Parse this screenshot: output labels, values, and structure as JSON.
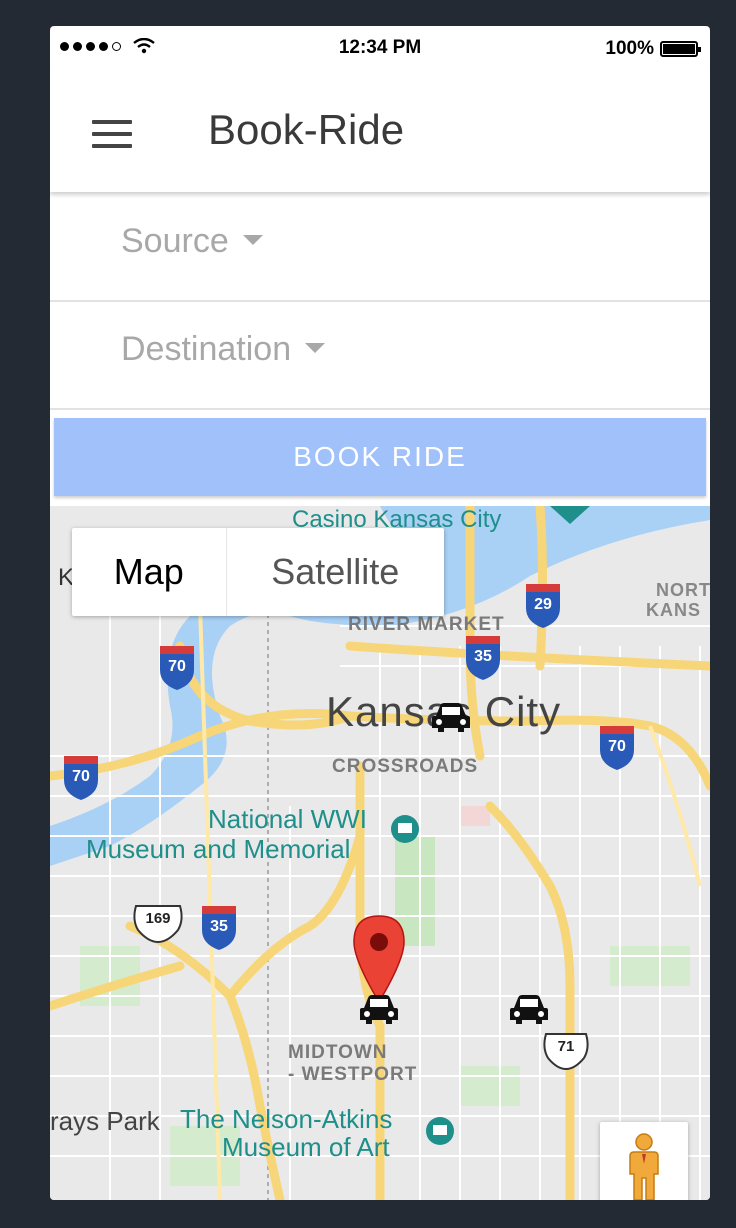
{
  "status_bar": {
    "time": "12:34 PM",
    "battery": "100%"
  },
  "app_bar": {
    "title": "Book-Ride",
    "menu_icon": "hamburger-menu-icon"
  },
  "form": {
    "source_label": "Source",
    "destination_label": "Destination",
    "book_button": "BOOK RIDE"
  },
  "map": {
    "type_control": {
      "map": "Map",
      "satellite": "Satellite",
      "selected": "Map"
    },
    "labels": {
      "casino": "Casino Kansas City",
      "river_market": "RIVER MARKET",
      "kansas_city": "Kansas City",
      "crossroads": "CROSSROADS",
      "wwi_line1": "National WWI",
      "wwi_line2": "Museum and Memorial",
      "midtown1": "MIDTOWN",
      "midtown2": "- WESTPORT",
      "nelson1": "The Nelson-Atkins",
      "nelson2": "Museum of Art",
      "park": "rays Park",
      "north1": "NORT",
      "north2": "KANS",
      "left_k": "K"
    },
    "shields": {
      "i29": "29",
      "i35a": "35",
      "i70a": "70",
      "i70b": "70",
      "i70c": "70",
      "i35b": "35",
      "us169": "169",
      "us71": "71"
    },
    "icons": [
      "car-icon",
      "map-pin-icon",
      "pegman-icon"
    ],
    "colors": {
      "road_major": "#f7d67a",
      "road_minor": "#ffffff",
      "water": "#a9d0f5",
      "park": "#c8e6c0",
      "pin": "#ea4335",
      "poi_teal": "#1e8f8a"
    }
  }
}
